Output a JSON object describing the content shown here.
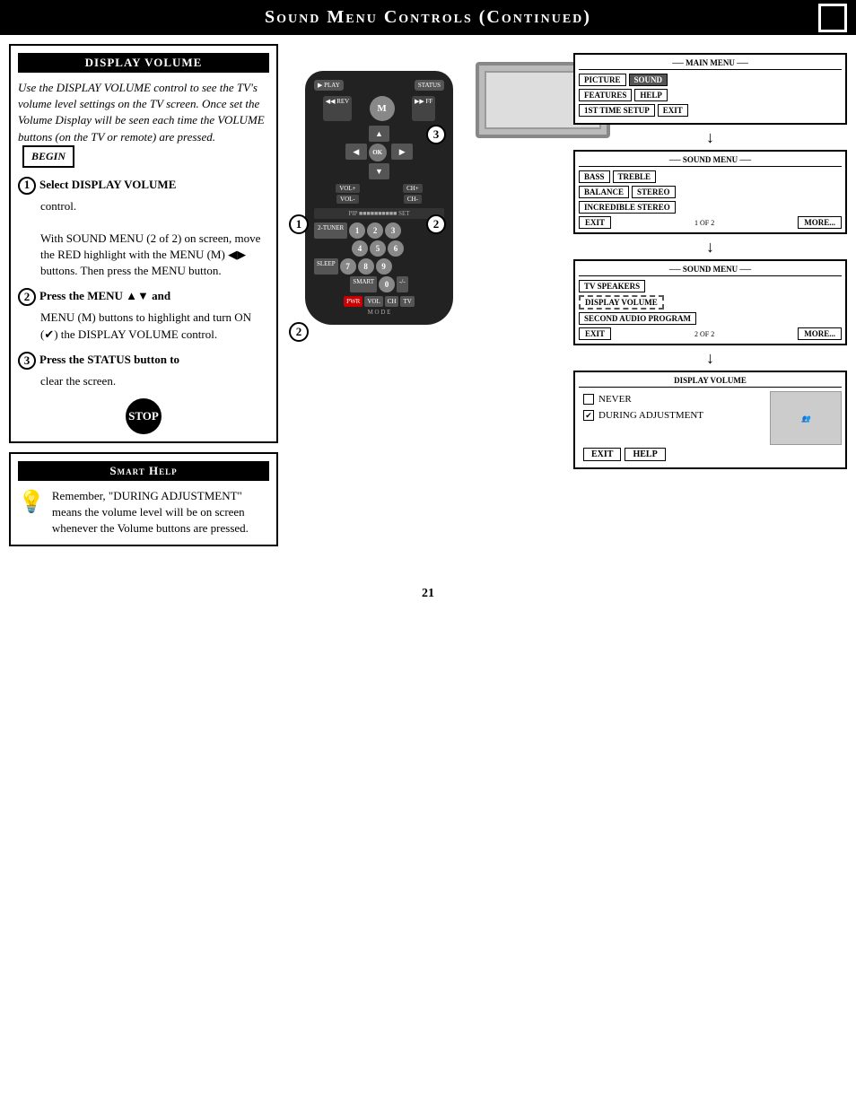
{
  "page": {
    "title": "Sound Menu Controls (Continued)",
    "page_number": "21",
    "header_title": "Sound Menu Controls (Continued)"
  },
  "display_volume_section": {
    "title": "DISPLAY VOLUME",
    "intro": "Use the DISPLAY VOLUME control to see the TV's volume level settings on the TV screen. Once set the Volume Display will be seen each time the VOLUME buttons (on the TV or remote) are pressed.",
    "begin_label": "BEGIN",
    "step1_header": "Select DISPLAY VOLUME",
    "step1_body": "control.",
    "step1_detail": "With SOUND MENU (2 of 2) on screen, move the RED highlight with the MENU (M) ◀▶ buttons. Then press the MENU button.",
    "step2_header": "Press the MENU ▲▼ and",
    "step2_body": "MENU (M) buttons to highlight and turn ON (✔) the DISPLAY VOLUME control.",
    "step3_header": "Press the STATUS button to",
    "step3_body": "clear the screen.",
    "stop_label": "STOP"
  },
  "smart_help": {
    "title": "Smart Help",
    "text": "Remember, \"DURING ADJUSTMENT\" means the volume level will be on screen whenever the Volume buttons are pressed."
  },
  "main_menu_screen": {
    "title": "MAIN MENU",
    "buttons": [
      "PICTURE",
      "SOUND",
      "FEATURES",
      "HELP",
      "1ST TIME SETUP",
      "EXIT"
    ]
  },
  "sound_menu_1": {
    "title": "SOUND MENU",
    "items": [
      "BASS",
      "TREBLE",
      "BALANCE",
      "STEREO",
      "INCREDIBLE STEREO"
    ],
    "exit": "EXIT",
    "more": "MORE...",
    "page": "1 OF 2"
  },
  "sound_menu_2": {
    "title": "SOUND MENU",
    "items": [
      "TV SPEAKERS",
      "DISPLAY VOLUME",
      "SECOND AUDIO PROGRAM"
    ],
    "exit": "EXIT",
    "more": "MORE...",
    "page": "2 OF 2"
  },
  "display_vol_options": {
    "title": "DISPLAY VOLUME",
    "option1": "NEVER",
    "option2": "DURING ADJUSTMENT",
    "exit": "EXIT",
    "help": "HELP"
  },
  "steps_on_remote": {
    "step1": "1",
    "step2": "2",
    "step3": "3"
  }
}
